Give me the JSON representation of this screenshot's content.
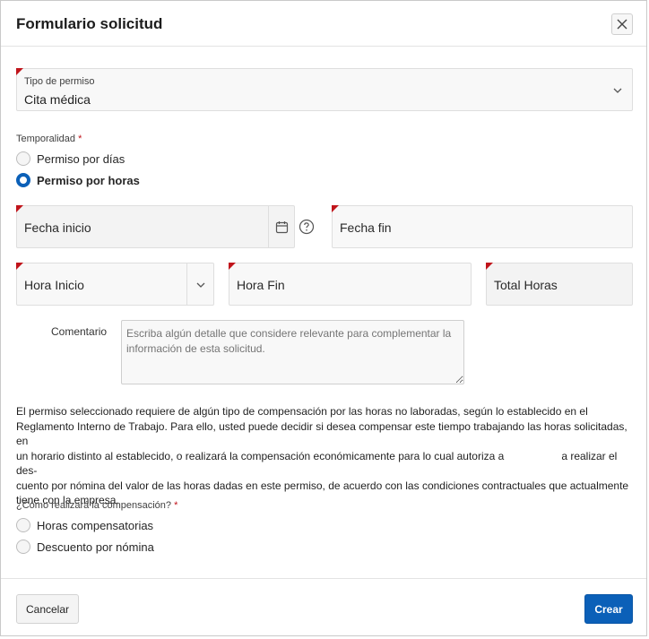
{
  "dialog": {
    "title": "Formulario solicitud",
    "close_icon": "close-icon"
  },
  "tipo_permiso": {
    "label": "Tipo de permiso",
    "value": "Cita médica"
  },
  "temporalidad": {
    "label": "Temporalidad",
    "required_mark": "*",
    "options": [
      {
        "label": "Permiso por días",
        "checked": false
      },
      {
        "label": "Permiso por horas",
        "checked": true
      }
    ]
  },
  "fecha_inicio": {
    "label": "Fecha inicio",
    "icon": "calendar-icon"
  },
  "help_icon": "help-icon",
  "fecha_fin": {
    "label": "Fecha fin"
  },
  "hora_inicio": {
    "label": "Hora Inicio"
  },
  "hora_fin": {
    "label": "Hora Fin"
  },
  "total_horas": {
    "label": "Total Horas"
  },
  "comentario": {
    "label": "Comentario",
    "placeholder": "Escriba algún detalle que considere relevante para complementar la información de esta solicitud."
  },
  "info_text": {
    "line1": "El permiso seleccionado requiere de algún tipo de compensación por las horas no laboradas, según lo establecido en el",
    "line2": "Reglamento Interno de Trabajo. Para ello, usted puede decidir si desea compensar este tiempo trabajando las horas solicitadas, en",
    "line3a": "un horario distinto al establecido, o realizará la compensación económicamente para lo cual autoriza a",
    "line3b": "a realizar el des-",
    "line4": "cuento por nómina del valor de las horas dadas en este permiso, de acuerdo con las condiciones contractuales que actualmente",
    "line5": "tiene con la empresa."
  },
  "compensacion": {
    "label": "¿Cómo realizará la compensación?",
    "required_mark": "*",
    "options": [
      {
        "label": "Horas compensatorias",
        "checked": false
      },
      {
        "label": "Descuento por nómina",
        "checked": false
      }
    ]
  },
  "footer": {
    "cancel_label": "Cancelar",
    "create_label": "Crear"
  },
  "colors": {
    "primary": "#0b60b8",
    "required": "#c0141b"
  }
}
